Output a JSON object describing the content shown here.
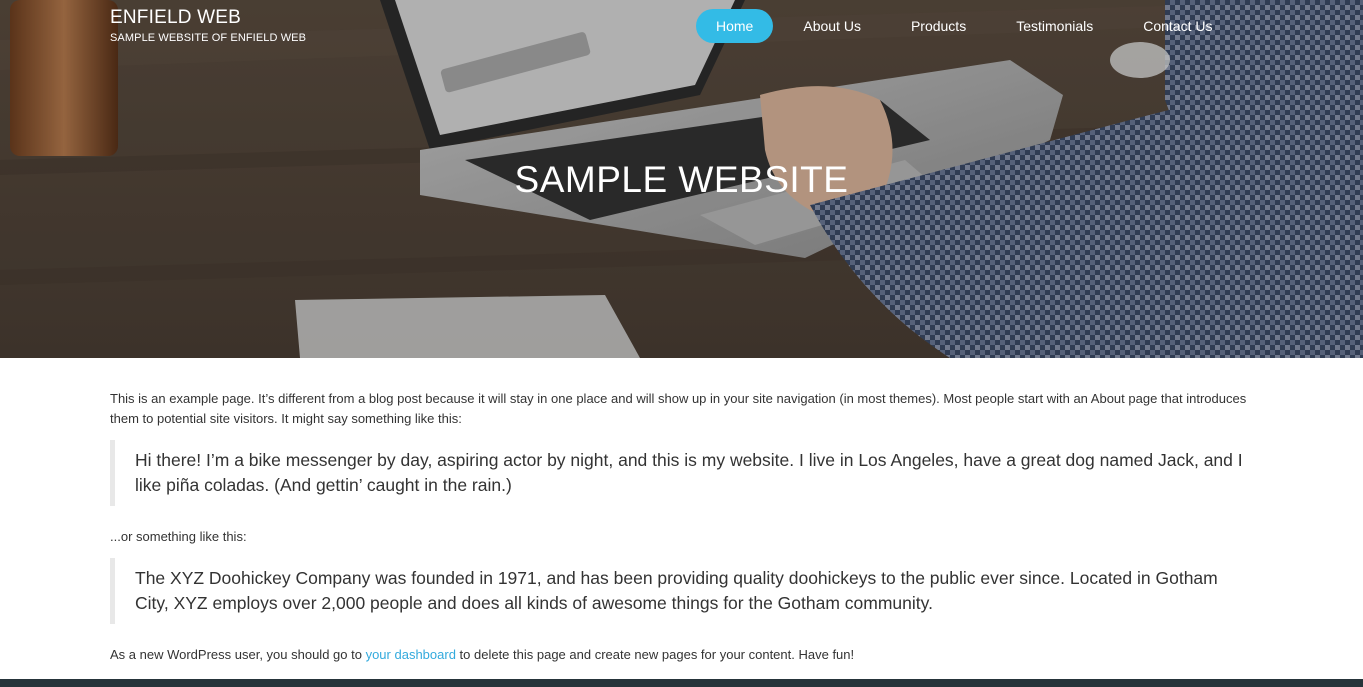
{
  "header": {
    "site_title": "ENFIELD WEB",
    "tagline": "SAMPLE WEBSITE OF ENFIELD WEB",
    "hero_title": "SAMPLE WEBSITE"
  },
  "nav": {
    "items": [
      {
        "label": "Home",
        "active": true
      },
      {
        "label": "About Us",
        "active": false
      },
      {
        "label": "Products",
        "active": false
      },
      {
        "label": "Testimonials",
        "active": false
      },
      {
        "label": "Contact Us",
        "active": false
      }
    ],
    "active_color": "#33bbe6"
  },
  "content": {
    "intro": "This is an example page. It’s different from a blog post because it will stay in one place and will show up in your site navigation (in most themes). Most people start with an About page that introduces them to potential site visitors. It might say something like this:",
    "quote1": "Hi there! I’m a bike messenger by day, aspiring actor by night, and this is my website. I live in Los Angeles, have a great dog named Jack, and I like piña coladas. (And gettin’ caught in the rain.)",
    "middle": "...or something like this:",
    "quote2": "The XYZ Doohickey Company was founded in 1971, and has been providing quality doohickeys to the public ever since. Located in Gotham City, XYZ employs over 2,000 people and does all kinds of awesome things for the Gotham community.",
    "outro_before": "As a new WordPress user, you should go to ",
    "outro_link": "your dashboard",
    "outro_after": " to delete this page and create new pages for your content. Have fun!"
  },
  "colors": {
    "link": "#33aadd",
    "footer": "#26343a",
    "quote_border": "#e8e8e8"
  }
}
